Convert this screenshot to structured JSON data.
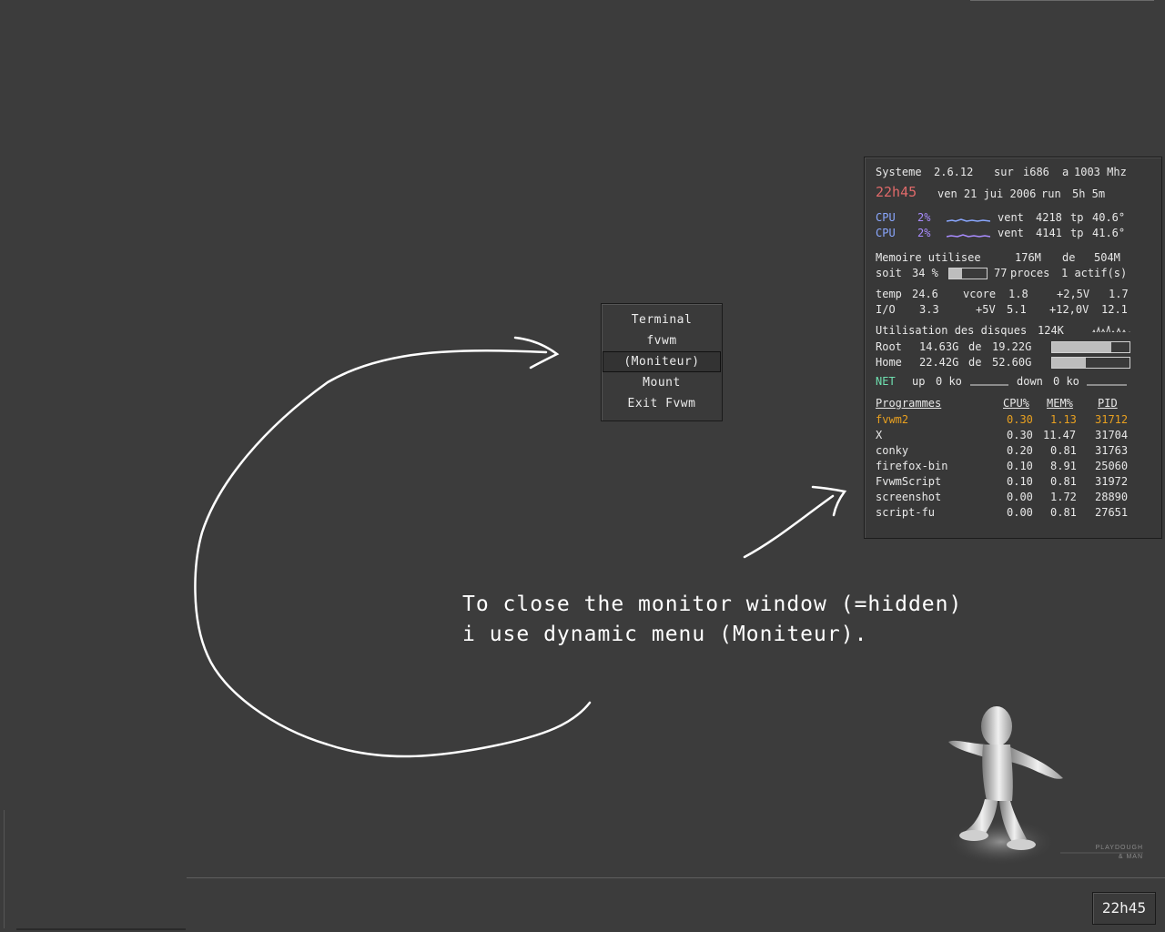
{
  "menu": {
    "items": [
      {
        "label": "Terminal",
        "selected": false
      },
      {
        "label": "fvwm",
        "selected": false
      },
      {
        "label": "(Moniteur)",
        "selected": true
      },
      {
        "label": "Mount",
        "selected": false
      },
      {
        "label": "Exit Fvwm",
        "selected": false
      }
    ]
  },
  "monitor": {
    "system": {
      "label": "Systeme",
      "kernel": "2.6.12",
      "sur": "sur",
      "arch": "i686",
      "a": "a",
      "freq": "1003 Mhz"
    },
    "clock": {
      "time": "22h45",
      "date": "ven 21 jui 2006",
      "run_label": "run",
      "uptime": "5h 5m"
    },
    "cpus": [
      {
        "label": "CPU",
        "value": "2%",
        "vent_label": "vent",
        "vent": "4218",
        "tp_label": "tp",
        "tp": "40.6°"
      },
      {
        "label": "CPU",
        "value": "2%",
        "vent_label": "vent",
        "vent": "4141",
        "tp_label": "tp",
        "tp": "41.6°"
      }
    ],
    "memory": {
      "label": "Memoire utilisee",
      "used": "176M",
      "de": "de",
      "total": "504M",
      "soit": "soit",
      "percent": "34 %",
      "percent_fraction": 0.34,
      "procs": "77",
      "procs_label": "proces",
      "actif": "1 actif(s)"
    },
    "sensors": {
      "temp_label": "temp",
      "temp": "24.6",
      "vcore_label": "vcore",
      "vcore": "1.8",
      "v25_label": "+2,5V",
      "v25": "1.7",
      "io_label": "I/O",
      "io": "3.3",
      "v5_label": "+5V",
      "v5": "5.1",
      "v12_label": "+12,0V",
      "v12": "12.1"
    },
    "disks": {
      "label": "Utilisation des disques",
      "io": "124K",
      "root": {
        "label": "Root",
        "used": "14.63G",
        "de": "de",
        "total": "19.22G",
        "fraction": 0.76
      },
      "home": {
        "label": "Home",
        "used": "22.42G",
        "de": "de",
        "total": "52.60G",
        "fraction": 0.43
      }
    },
    "net": {
      "label": "NET",
      "up_label": "up",
      "up": "0 ko",
      "down_label": "down",
      "down": "0 ko"
    },
    "processes": {
      "headers": [
        "Programmes",
        "CPU%",
        "MEM%",
        "PID"
      ],
      "rows": [
        {
          "name": "fvwm2",
          "cpu": "0.30",
          "mem": "1.13",
          "pid": "31712",
          "highlight": true
        },
        {
          "name": "X",
          "cpu": "0.30",
          "mem": "11.47",
          "pid": "31704"
        },
        {
          "name": "conky",
          "cpu": "0.20",
          "mem": "0.81",
          "pid": "31763"
        },
        {
          "name": "firefox-bin",
          "cpu": "0.10",
          "mem": "8.91",
          "pid": "25060"
        },
        {
          "name": "FvwmScript",
          "cpu": "0.10",
          "mem": "0.81",
          "pid": "31972"
        },
        {
          "name": "screenshot",
          "cpu": "0.00",
          "mem": "1.72",
          "pid": "28890"
        },
        {
          "name": "script-fu",
          "cpu": "0.00",
          "mem": "0.81",
          "pid": "27651"
        }
      ]
    }
  },
  "annotation": {
    "line1": "To close the monitor window (=hidden)",
    "line2": "i use dynamic menu (Moniteur)."
  },
  "taskbar": {
    "clock": "22h45"
  },
  "wallpaper": {
    "brand_line1": "PLAYDOUGH",
    "brand_line2": "& MAN"
  },
  "colors": {
    "background": "#3c3c3c",
    "time": "#e06a6a",
    "cpu": "#8aa7ff",
    "net": "#6fe0b0",
    "highlight": "#e8a020"
  }
}
